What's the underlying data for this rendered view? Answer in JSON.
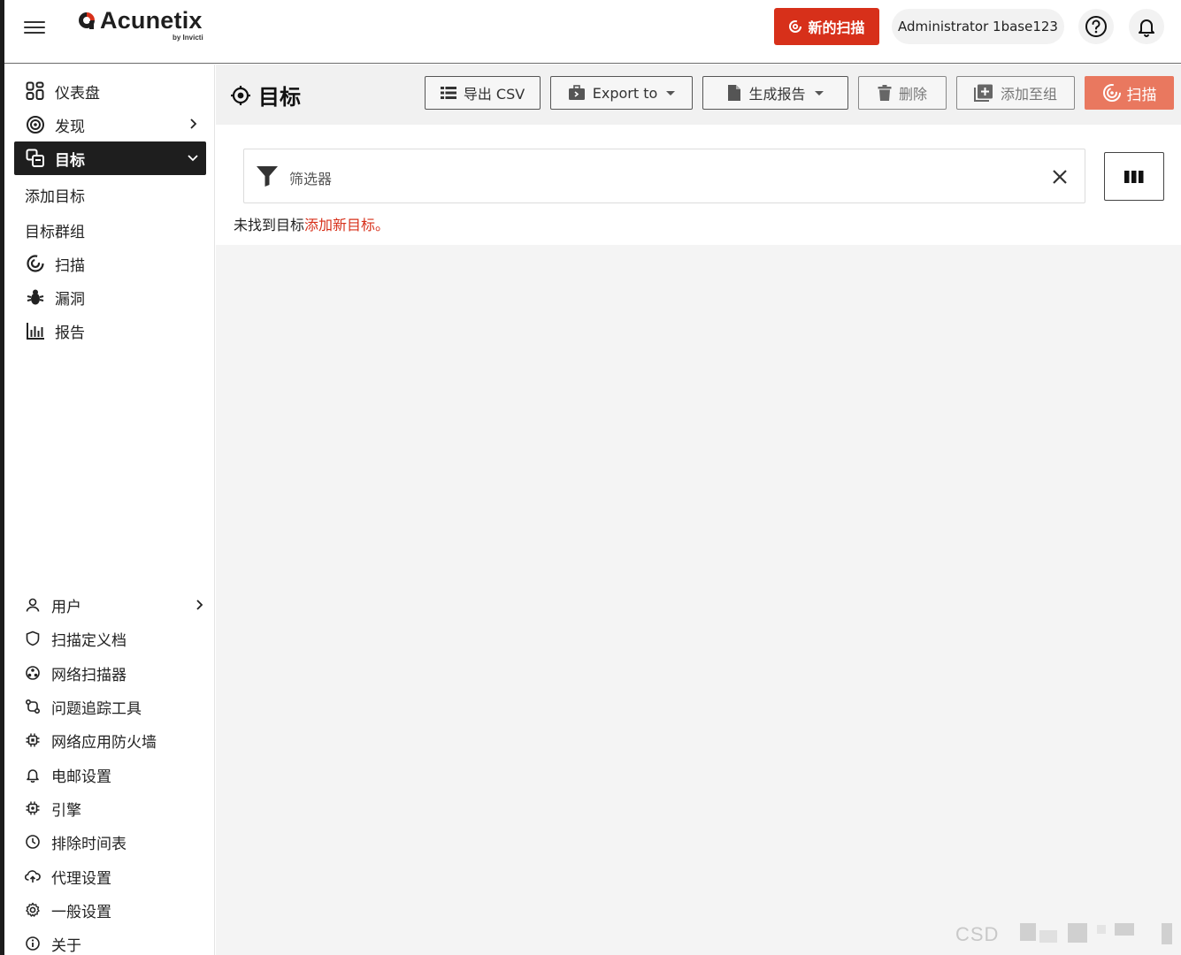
{
  "header": {
    "logo_text": "Acunetix",
    "logo_sub": "by Invicti",
    "new_scan_label": "新的扫描",
    "user_name": "Administrator 1base123"
  },
  "sidebar": {
    "items": [
      {
        "label": "仪表盘",
        "icon": "dashboard-icon"
      },
      {
        "label": "发现",
        "icon": "target-circle-icon"
      },
      {
        "label": "目标",
        "icon": "targets-icon"
      },
      {
        "label": "扫描",
        "icon": "scan-icon"
      },
      {
        "label": "漏洞",
        "icon": "bug-icon"
      },
      {
        "label": "报告",
        "icon": "bar-chart-icon"
      }
    ],
    "sub_items": [
      {
        "label": "添加目标"
      },
      {
        "label": "目标群组"
      }
    ],
    "bottom_items": [
      {
        "label": "用户",
        "icon": "user-icon"
      },
      {
        "label": "扫描定义档",
        "icon": "shield-icon"
      },
      {
        "label": "网络扫描器",
        "icon": "network-scanner-icon"
      },
      {
        "label": "问题追踪工具",
        "icon": "issue-tracker-icon"
      },
      {
        "label": "网络应用防火墙",
        "icon": "chip-icon"
      },
      {
        "label": "电邮设置",
        "icon": "bell-icon"
      },
      {
        "label": "引擎",
        "icon": "engine-icon"
      },
      {
        "label": "排除时间表",
        "icon": "clock-icon"
      },
      {
        "label": "代理设置",
        "icon": "proxy-icon"
      },
      {
        "label": "一般设置",
        "icon": "gear-icon"
      },
      {
        "label": "关于",
        "icon": "info-icon"
      }
    ]
  },
  "main": {
    "title": "目标",
    "toolbar": {
      "export_csv": "导出 CSV",
      "export_to": "Export to",
      "generate_report": "生成报告",
      "delete": "删除",
      "add_to_group": "添加至组",
      "scan": "扫描"
    },
    "filter": {
      "label": "筛选器"
    },
    "empty_message": "未找到目标",
    "empty_link": "添加新目标。"
  },
  "watermark": "CSD",
  "colors": {
    "accent": "#d7301a",
    "scan_button": "#e9785f",
    "active_nav": "#1e1e1e"
  }
}
